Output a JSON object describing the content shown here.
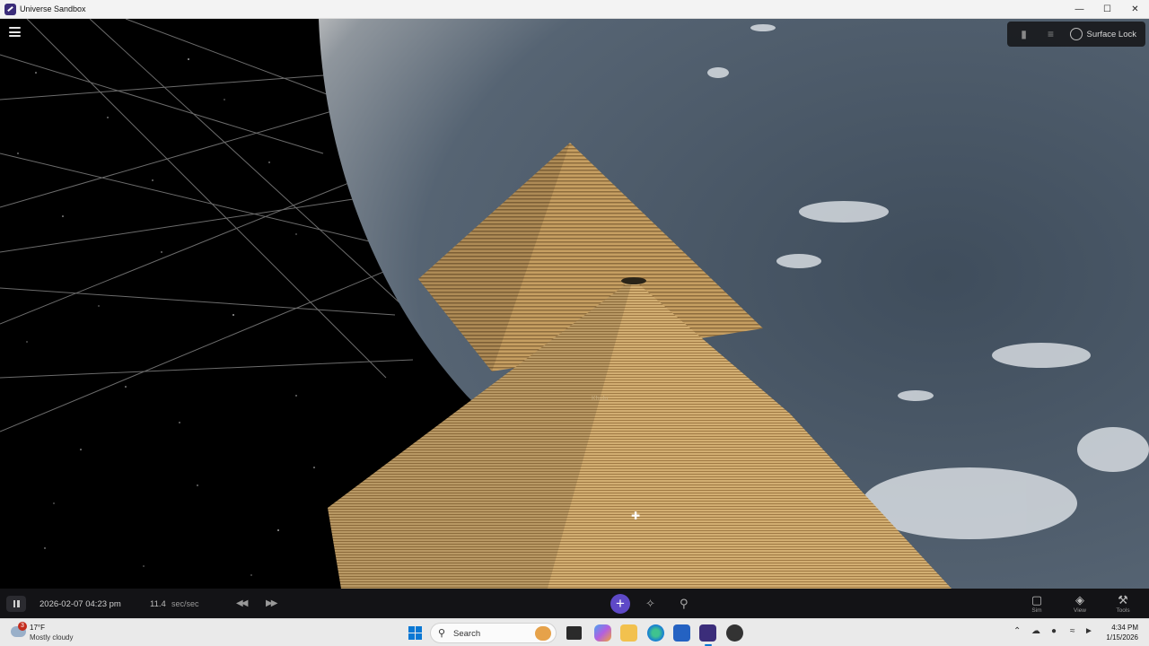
{
  "window": {
    "title": "Universe Sandbox",
    "controls": [
      "minimize",
      "maximize",
      "close"
    ]
  },
  "scene": {
    "object_label": "Khufu",
    "top_right": {
      "flashlight_icon": "flashlight-icon",
      "settings_icon": "sliders-icon",
      "surface_lock_label": "Surface Lock"
    }
  },
  "simbar": {
    "date": "2026-02-07 04:23 pm",
    "rate_value": "11.4",
    "rate_unit": "sec/sec",
    "tools": [
      {
        "label": "Sim",
        "icon": "cube-icon"
      },
      {
        "label": "View",
        "icon": "layers-icon"
      },
      {
        "label": "Tools",
        "icon": "wrench-icon"
      }
    ]
  },
  "taskbar": {
    "weather": {
      "badge": "3",
      "temp": "17°F",
      "desc": "Mostly cloudy"
    },
    "search_placeholder": "Search",
    "clock": {
      "time": "4:34 PM",
      "date": "1/15/2026"
    }
  },
  "colors": {
    "accent": "#5e49c7",
    "sandstone": "#c9a46a",
    "planet": "#52606e"
  }
}
